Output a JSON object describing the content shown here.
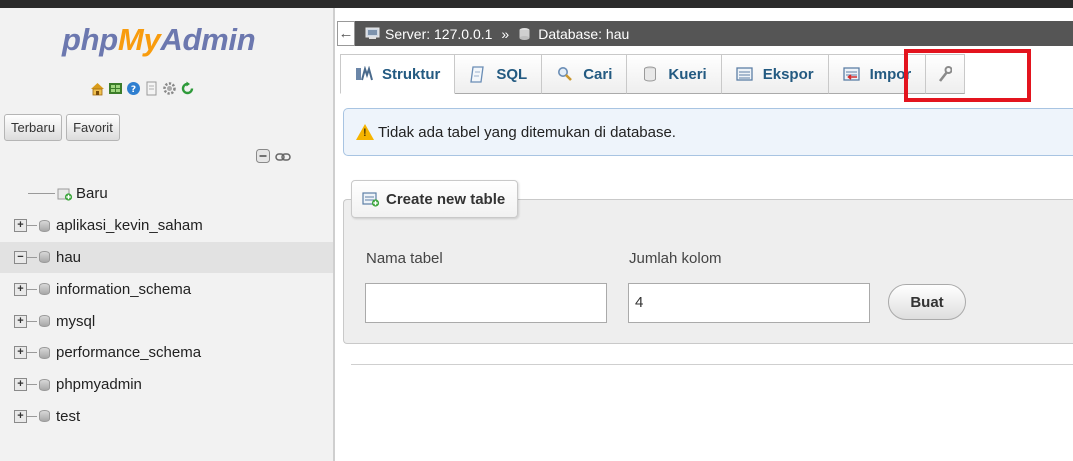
{
  "logo": {
    "part1": "php",
    "part2": "My",
    "part3": "Admin"
  },
  "sidebar": {
    "icons": [
      "home-icon",
      "database-icon",
      "help-icon",
      "docs-icon",
      "settings-icon",
      "reload-icon"
    ],
    "buttons": {
      "recent": "Terbaru",
      "favorites": "Favorit"
    },
    "tree": [
      {
        "label": "Baru",
        "type": "new"
      },
      {
        "label": "aplikasi_kevin_saham",
        "type": "db",
        "expander": "+"
      },
      {
        "label": "hau",
        "type": "db",
        "expander": "−",
        "selected": true
      },
      {
        "label": "information_schema",
        "type": "db",
        "expander": "+"
      },
      {
        "label": "mysql",
        "type": "db",
        "expander": "+"
      },
      {
        "label": "performance_schema",
        "type": "db",
        "expander": "+"
      },
      {
        "label": "phpmyadmin",
        "type": "db",
        "expander": "+"
      },
      {
        "label": "test",
        "type": "db",
        "expander": "+"
      }
    ]
  },
  "breadcrumb": {
    "back": "←",
    "server": "Server: 127.0.0.1",
    "separator": "»",
    "database": "Database: hau"
  },
  "tabs": [
    {
      "label": "Struktur",
      "icon": "structure-icon"
    },
    {
      "label": "SQL",
      "icon": "sql-icon"
    },
    {
      "label": "Cari",
      "icon": "search-icon"
    },
    {
      "label": "Kueri",
      "icon": "query-icon"
    },
    {
      "label": "Ekspor",
      "icon": "export-icon"
    },
    {
      "label": "Impor",
      "icon": "import-icon"
    }
  ],
  "notice": "Tidak ada tabel yang ditemukan di database.",
  "create_table": {
    "legend": "Create new table",
    "name_label": "Nama tabel",
    "name_value": "",
    "columns_label": "Jumlah kolom",
    "columns_value": "4",
    "submit": "Buat"
  },
  "colors": {
    "logo_blue": "#6c78af",
    "logo_orange": "#f89c0e",
    "tab_text": "#235a81",
    "highlight": "#e3141e",
    "notice_bg": "#eef4fb"
  }
}
